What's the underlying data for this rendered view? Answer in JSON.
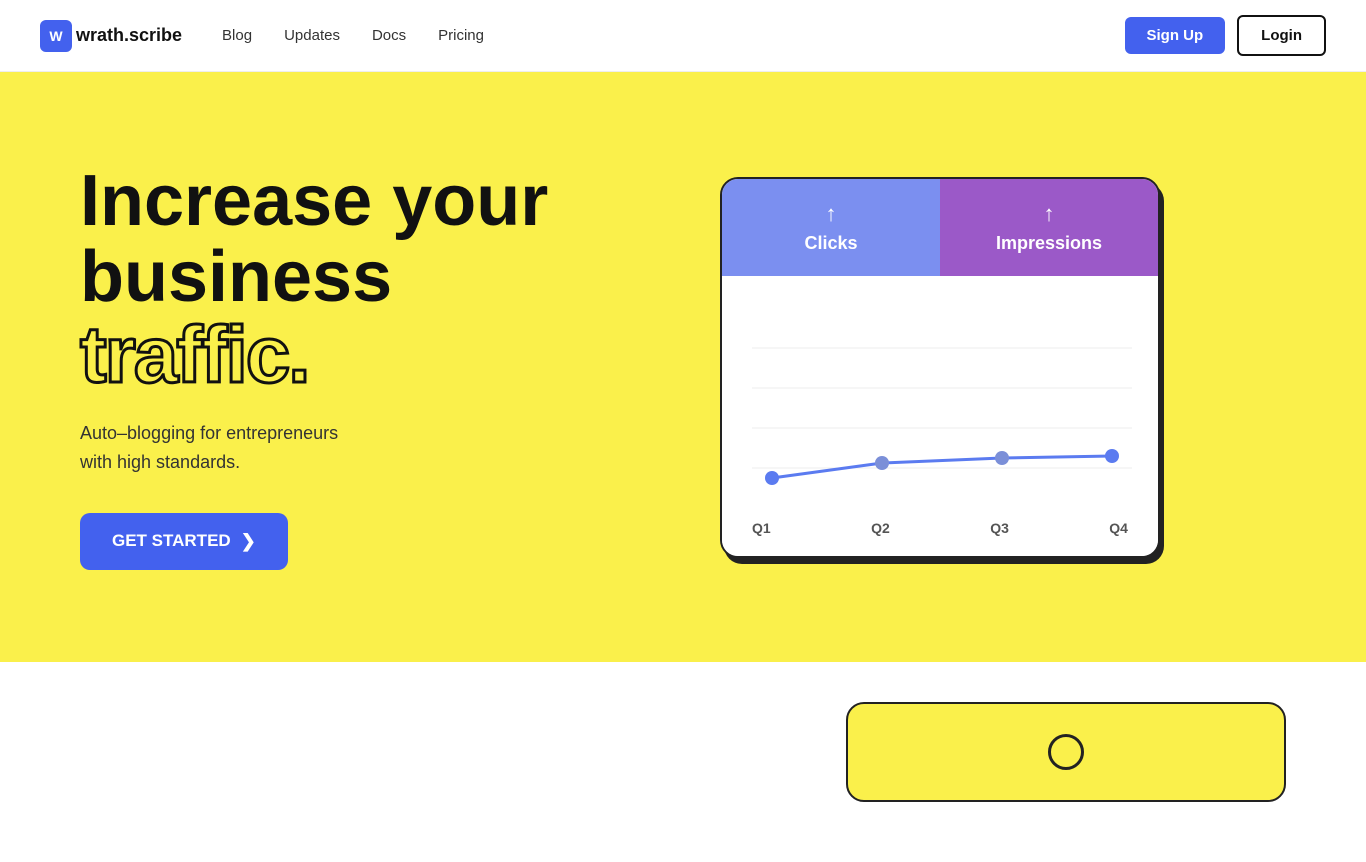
{
  "nav": {
    "logo_text": "wrath.scribe",
    "logo_letter": "W",
    "links": [
      {
        "label": "Blog",
        "href": "#"
      },
      {
        "label": "Updates",
        "href": "#"
      },
      {
        "label": "Docs",
        "href": "#"
      },
      {
        "label": "Pricing",
        "href": "#"
      }
    ],
    "signup_label": "Sign Up",
    "login_label": "Login"
  },
  "hero": {
    "title_line1": "Increase your",
    "title_line2": "business",
    "title_traffic": "traffic.",
    "subtitle_line1": "Auto–blogging for entrepreneurs",
    "subtitle_line2": "with high standards.",
    "cta_label": "GET STARTED",
    "cta_arrow": "❯"
  },
  "chart": {
    "tab_clicks": "Clicks",
    "tab_impressions": "Impressions",
    "arrow_up": "↑",
    "quarters": [
      "Q1",
      "Q2",
      "Q3",
      "Q4"
    ]
  },
  "colors": {
    "yellow": "#FAF04B",
    "blue_tab": "#7B8FF0",
    "purple_tab": "#9B59C8",
    "cta_blue": "#4361EE",
    "line_blue": "#5B7BF0",
    "dark": "#111"
  }
}
